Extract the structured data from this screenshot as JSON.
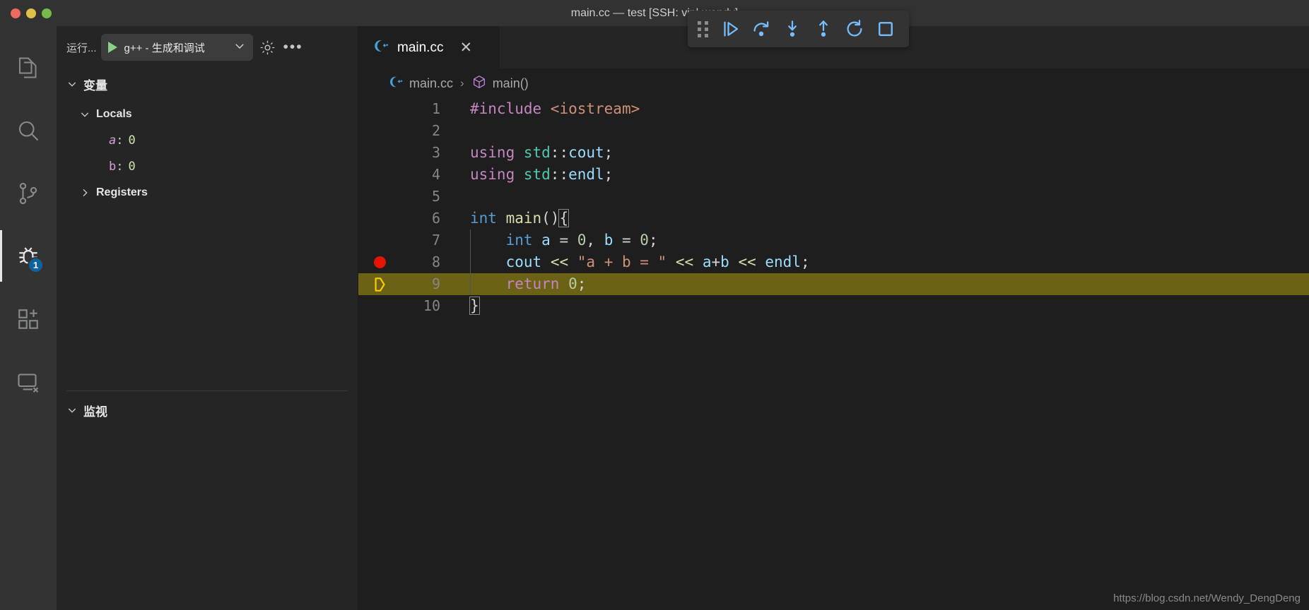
{
  "window": {
    "title": "main.cc — test [SSH: vipl-wendy]",
    "traffic_lights": [
      {
        "name": "close",
        "color": "#ec6a5f"
      },
      {
        "name": "minimize",
        "color": "#e0c04b"
      },
      {
        "name": "zoom",
        "color": "#75bb4c"
      }
    ]
  },
  "activity_bar": {
    "items": [
      {
        "name": "explorer",
        "icon": "files-icon",
        "active": false
      },
      {
        "name": "search",
        "icon": "search-icon",
        "active": false
      },
      {
        "name": "source-control",
        "icon": "source-control-icon",
        "active": false
      },
      {
        "name": "run-and-debug",
        "icon": "debug-icon",
        "active": true,
        "badge": "1"
      },
      {
        "name": "extensions",
        "icon": "extensions-icon",
        "active": false
      },
      {
        "name": "remote-explorer",
        "icon": "remote-explorer-icon",
        "active": false
      }
    ]
  },
  "debug_sidebar": {
    "run_label": "运行...",
    "configuration": "g++ - 生成和调试",
    "play_icon": "play-icon",
    "chevron_icon": "chevron-down-icon",
    "gear_icon": "gear-icon",
    "more_icon": "more-actions-icon",
    "variables_section": {
      "title": "变量",
      "expanded": true,
      "groups": [
        {
          "label": "Locals",
          "expanded": true,
          "variables": [
            {
              "name": "a",
              "value": "0"
            },
            {
              "name": "b",
              "value": "0"
            }
          ]
        },
        {
          "label": "Registers",
          "expanded": false,
          "variables": []
        }
      ]
    },
    "watch_section": {
      "title": "监视",
      "expanded": true,
      "items": []
    }
  },
  "editor": {
    "tab": {
      "label": "main.cc",
      "icon": "cpp-file-icon",
      "close_icon": "close-icon",
      "active": true
    },
    "breadcrumb": [
      {
        "label": "main.cc",
        "icon": "cpp-file-icon"
      },
      {
        "label": "main()",
        "icon": "symbol-method-icon"
      }
    ],
    "separator": "›",
    "lines": [
      {
        "number": "1",
        "breakpoint": false,
        "current": false,
        "indent_guide": false,
        "tokens": [
          {
            "t": "#include ",
            "c": "t-key"
          },
          {
            "t": "<iostream>",
            "c": "t-str"
          }
        ]
      },
      {
        "number": "2",
        "breakpoint": false,
        "current": false,
        "indent_guide": false,
        "tokens": []
      },
      {
        "number": "3",
        "breakpoint": false,
        "current": false,
        "indent_guide": false,
        "tokens": [
          {
            "t": "using ",
            "c": "t-key"
          },
          {
            "t": "std",
            "c": "t-ns"
          },
          {
            "t": "::",
            "c": "t-op"
          },
          {
            "t": "cout",
            "c": "t-var"
          },
          {
            "t": ";",
            "c": "t-op"
          }
        ]
      },
      {
        "number": "4",
        "breakpoint": false,
        "current": false,
        "indent_guide": false,
        "tokens": [
          {
            "t": "using ",
            "c": "t-key"
          },
          {
            "t": "std",
            "c": "t-ns"
          },
          {
            "t": "::",
            "c": "t-op"
          },
          {
            "t": "endl",
            "c": "t-var"
          },
          {
            "t": ";",
            "c": "t-op"
          }
        ]
      },
      {
        "number": "5",
        "breakpoint": false,
        "current": false,
        "indent_guide": false,
        "tokens": []
      },
      {
        "number": "6",
        "breakpoint": false,
        "current": false,
        "indent_guide": false,
        "tokens": [
          {
            "t": "int ",
            "c": "t-type"
          },
          {
            "t": "main",
            "c": "t-fn"
          },
          {
            "t": "()",
            "c": "t-op"
          },
          {
            "t": "{",
            "c": "t-op brk-match"
          }
        ]
      },
      {
        "number": "7",
        "breakpoint": false,
        "current": false,
        "indent_guide": true,
        "tokens": [
          {
            "t": "    ",
            "c": "t-op"
          },
          {
            "t": "int ",
            "c": "t-type"
          },
          {
            "t": "a",
            "c": "t-var"
          },
          {
            "t": " = ",
            "c": "t-op"
          },
          {
            "t": "0",
            "c": "t-num"
          },
          {
            "t": ", ",
            "c": "t-op"
          },
          {
            "t": "b",
            "c": "t-var"
          },
          {
            "t": " = ",
            "c": "t-op"
          },
          {
            "t": "0",
            "c": "t-num"
          },
          {
            "t": ";",
            "c": "t-op"
          }
        ]
      },
      {
        "number": "8",
        "breakpoint": true,
        "current": false,
        "indent_guide": true,
        "tokens": [
          {
            "t": "    ",
            "c": "t-op"
          },
          {
            "t": "cout",
            "c": "t-var"
          },
          {
            "t": " ",
            "c": "t-op"
          },
          {
            "t": "<<",
            "c": "t-shift"
          },
          {
            "t": " ",
            "c": "t-op"
          },
          {
            "t": "\"a + b = \"",
            "c": "t-str"
          },
          {
            "t": " ",
            "c": "t-op"
          },
          {
            "t": "<<",
            "c": "t-shift"
          },
          {
            "t": " ",
            "c": "t-op"
          },
          {
            "t": "a",
            "c": "t-var"
          },
          {
            "t": "+",
            "c": "t-op"
          },
          {
            "t": "b",
            "c": "t-var"
          },
          {
            "t": " ",
            "c": "t-op"
          },
          {
            "t": "<<",
            "c": "t-shift"
          },
          {
            "t": " ",
            "c": "t-op"
          },
          {
            "t": "endl",
            "c": "t-var"
          },
          {
            "t": ";",
            "c": "t-op"
          }
        ]
      },
      {
        "number": "9",
        "breakpoint": false,
        "current": true,
        "indent_guide": true,
        "tokens": [
          {
            "t": "    ",
            "c": "t-op"
          },
          {
            "t": "return ",
            "c": "t-key"
          },
          {
            "t": "0",
            "c": "t-num"
          },
          {
            "t": ";",
            "c": "t-op"
          }
        ]
      },
      {
        "number": "10",
        "breakpoint": false,
        "current": false,
        "indent_guide": false,
        "tokens": [
          {
            "t": "}",
            "c": "t-op brk-match"
          }
        ]
      }
    ]
  },
  "debug_toolbar": {
    "drag_handle": "drag-handle-icon",
    "buttons": [
      {
        "name": "continue",
        "icon": "continue-icon",
        "color": "#75beff"
      },
      {
        "name": "step-over",
        "icon": "step-over-icon",
        "color": "#75beff"
      },
      {
        "name": "step-into",
        "icon": "step-into-icon",
        "color": "#75beff"
      },
      {
        "name": "step-out",
        "icon": "step-out-icon",
        "color": "#75beff"
      },
      {
        "name": "restart",
        "icon": "restart-icon",
        "color": "#75beff"
      },
      {
        "name": "stop",
        "icon": "stop-icon",
        "color": "#75beff"
      }
    ]
  },
  "watermark": "https://blog.csdn.net/Wendy_DengDeng"
}
